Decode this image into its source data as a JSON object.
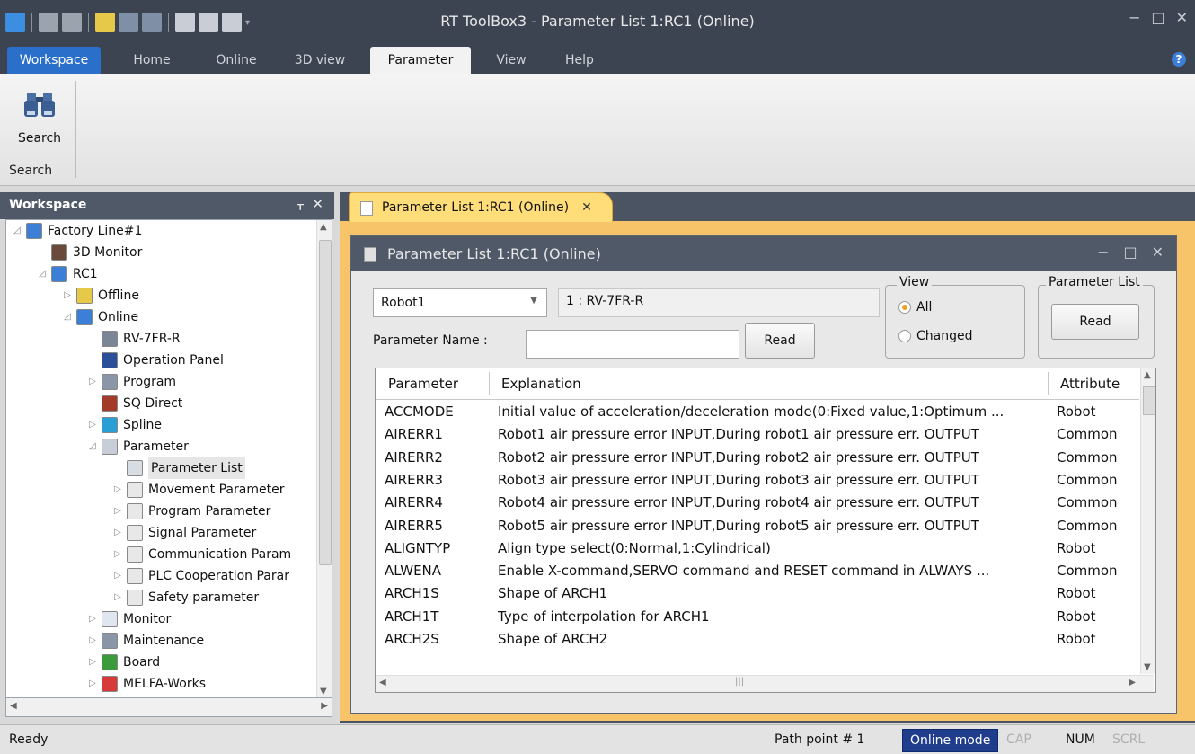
{
  "app": {
    "title": "RT ToolBox3 - Parameter List 1:RC1 (Online)",
    "window_controls": [
      "−",
      "□",
      "✕"
    ]
  },
  "ribbon": {
    "tabs": [
      "Workspace",
      "Home",
      "Online",
      "3D view",
      "Parameter",
      "View",
      "Help"
    ],
    "active_tab": "Parameter",
    "search_button": "Search",
    "group_label": "Search"
  },
  "workspace": {
    "title": "Workspace",
    "tree": [
      {
        "label": "Factory Line#1",
        "level": 0,
        "expander": "◿",
        "icon": "factory-icon"
      },
      {
        "label": "3D Monitor",
        "level": 1,
        "expander": "",
        "icon": "3d-monitor-icon"
      },
      {
        "label": "RC1",
        "level": 1,
        "expander": "◿",
        "icon": "robot-controller-icon"
      },
      {
        "label": "Offline",
        "level": 2,
        "expander": "▷",
        "icon": "offline-icon"
      },
      {
        "label": "Online",
        "level": 2,
        "expander": "◿",
        "icon": "online-icon"
      },
      {
        "label": "RV-7FR-R",
        "level": 3,
        "expander": "",
        "icon": "robot-model-icon"
      },
      {
        "label": "Operation Panel",
        "level": 3,
        "expander": "",
        "icon": "operation-panel-icon"
      },
      {
        "label": "Program",
        "level": 3,
        "expander": "▷",
        "icon": "program-icon"
      },
      {
        "label": "SQ Direct",
        "level": 3,
        "expander": "",
        "icon": "sq-direct-icon"
      },
      {
        "label": "Spline",
        "level": 3,
        "expander": "▷",
        "icon": "spline-icon"
      },
      {
        "label": "Parameter",
        "level": 3,
        "expander": "◿",
        "icon": "parameter-icon"
      },
      {
        "label": "Parameter List",
        "level": 4,
        "expander": "",
        "icon": "parameter-list-icon",
        "selected": true
      },
      {
        "label": "Movement Parameter",
        "level": 4,
        "expander": "▷",
        "icon": "document-icon"
      },
      {
        "label": "Program Parameter",
        "level": 4,
        "expander": "▷",
        "icon": "document-icon"
      },
      {
        "label": "Signal Parameter",
        "level": 4,
        "expander": "▷",
        "icon": "document-icon"
      },
      {
        "label": "Communication Param",
        "level": 4,
        "expander": "▷",
        "icon": "document-icon"
      },
      {
        "label": "PLC Cooperation Parar",
        "level": 4,
        "expander": "▷",
        "icon": "document-icon"
      },
      {
        "label": "Safety parameter",
        "level": 4,
        "expander": "▷",
        "icon": "document-icon"
      },
      {
        "label": "Monitor",
        "level": 3,
        "expander": "▷",
        "icon": "monitor-icon"
      },
      {
        "label": "Maintenance",
        "level": 3,
        "expander": "▷",
        "icon": "maintenance-icon"
      },
      {
        "label": "Board",
        "level": 3,
        "expander": "▷",
        "icon": "board-icon"
      },
      {
        "label": "MELFA-Works",
        "level": 3,
        "expander": "▷",
        "icon": "melfa-works-icon"
      }
    ]
  },
  "document": {
    "tab_label": "Parameter List 1:RC1 (Online)",
    "window_title": "Parameter List 1:RC1 (Online)",
    "robot_select": "Robot1",
    "robot_model": "1 : RV-7FR-R",
    "param_name_label": "Parameter Name :",
    "param_name_value": "",
    "read_label": "Read",
    "view_group": {
      "title": "View",
      "options": [
        "All",
        "Changed"
      ],
      "selected": "All"
    },
    "param_list_group": {
      "title": "Parameter List",
      "read_label": "Read"
    },
    "table": {
      "headers": [
        "Parameter",
        "Explanation",
        "Attribute"
      ],
      "rows": [
        [
          "ACCMODE",
          "Initial value of acceleration/deceleration mode(0:Fixed value,1:Optimum ...",
          "Robot"
        ],
        [
          "AIRERR1",
          "Robot1 air pressure error INPUT,During robot1 air pressure err. OUTPUT",
          "Common"
        ],
        [
          "AIRERR2",
          "Robot2 air pressure error INPUT,During robot2 air pressure err. OUTPUT",
          "Common"
        ],
        [
          "AIRERR3",
          "Robot3 air pressure error INPUT,During robot3 air pressure err. OUTPUT",
          "Common"
        ],
        [
          "AIRERR4",
          "Robot4 air pressure error INPUT,During robot4 air pressure err. OUTPUT",
          "Common"
        ],
        [
          "AIRERR5",
          "Robot5 air pressure error INPUT,During robot5 air pressure err. OUTPUT",
          "Common"
        ],
        [
          "ALIGNTYP",
          "Align type select(0:Normal,1:Cylindrical)",
          "Robot"
        ],
        [
          "ALWENA",
          "Enable X-command,SERVO command and RESET command in ALWAYS ...",
          "Common"
        ],
        [
          "ARCH1S",
          "Shape of ARCH1",
          "Robot"
        ],
        [
          "ARCH1T",
          "Type of interpolation for ARCH1",
          "Robot"
        ],
        [
          "ARCH2S",
          "Shape of ARCH2",
          "Robot"
        ]
      ]
    }
  },
  "status": {
    "text": "Ready",
    "path_point": "Path point # 1",
    "mode": "Online mode",
    "cap": "CAP",
    "num": "NUM",
    "scrl": "SCRL"
  },
  "colors": {
    "titlebar": "#3d4451",
    "accent_tab": "#2a6fc9",
    "doc_tab": "#ffde7a",
    "status_online": "#1f3d8c"
  }
}
